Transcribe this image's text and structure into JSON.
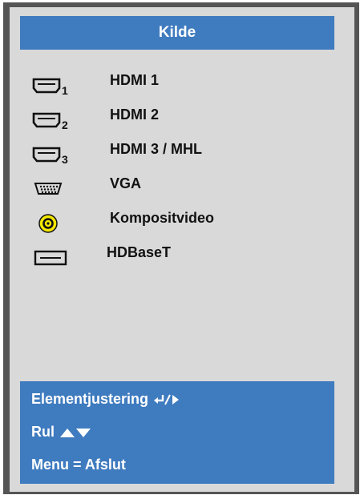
{
  "menu": {
    "title": "Kilde"
  },
  "sources": [
    {
      "label": "HDMI 1",
      "icon": "hdmi-1-icon",
      "subscript": "1"
    },
    {
      "label": "HDMI 2",
      "icon": "hdmi-2-icon",
      "subscript": "2"
    },
    {
      "label": "HDMI 3 / MHL",
      "icon": "hdmi-3-icon",
      "subscript": "3"
    },
    {
      "label": "VGA",
      "icon": "vga-icon"
    },
    {
      "label": "Kompositvideo",
      "icon": "composite-video-icon"
    },
    {
      "label": "HDBaseT",
      "icon": "hdbaset-icon"
    }
  ],
  "hints": {
    "adjust": "Elementjustering",
    "scroll": "Rul",
    "exit": "Menu = Afslut"
  },
  "colors": {
    "panel_bg": "#d9d9d9",
    "accent_blue": "#3f7bbf",
    "frame": "#555555",
    "composite_yellow": "#f2e600"
  }
}
